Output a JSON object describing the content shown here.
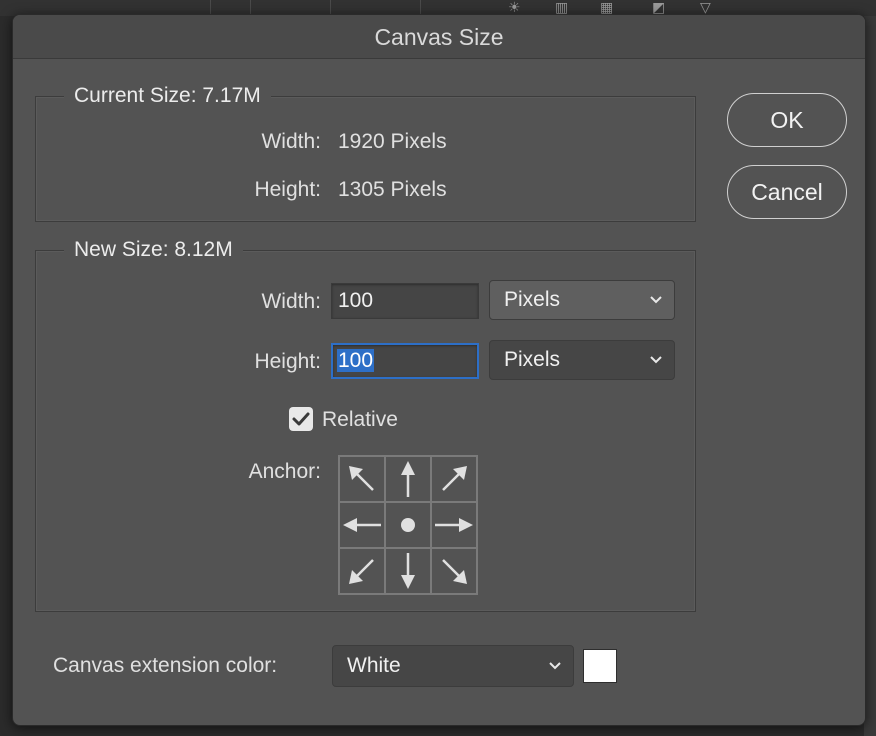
{
  "dialog": {
    "title": "Canvas Size"
  },
  "current_size": {
    "legend": "Current Size: 7.17M",
    "width_label": "Width:",
    "width_value": "1920 Pixels",
    "height_label": "Height:",
    "height_value": "1305 Pixels"
  },
  "new_size": {
    "legend": "New Size: 8.12M",
    "width_label": "Width:",
    "width_value": "100",
    "width_unit": "Pixels",
    "height_label": "Height:",
    "height_value": "100",
    "height_unit": "Pixels",
    "relative_label": "Relative",
    "relative_checked": true,
    "anchor_label": "Anchor:",
    "anchor_cells": [
      "arrow-up-left-icon",
      "arrow-up-icon",
      "arrow-up-right-icon",
      "arrow-left-icon",
      "anchor-center-dot-icon",
      "arrow-right-icon",
      "arrow-down-left-icon",
      "arrow-down-icon",
      "arrow-down-right-icon"
    ]
  },
  "extension": {
    "label": "Canvas extension color:",
    "value": "White",
    "swatch_color": "#ffffff"
  },
  "buttons": {
    "ok": "OK",
    "cancel": "Cancel"
  },
  "colors": {
    "dialog_bg": "#535353",
    "focus_accent": "#2d6fc7"
  }
}
